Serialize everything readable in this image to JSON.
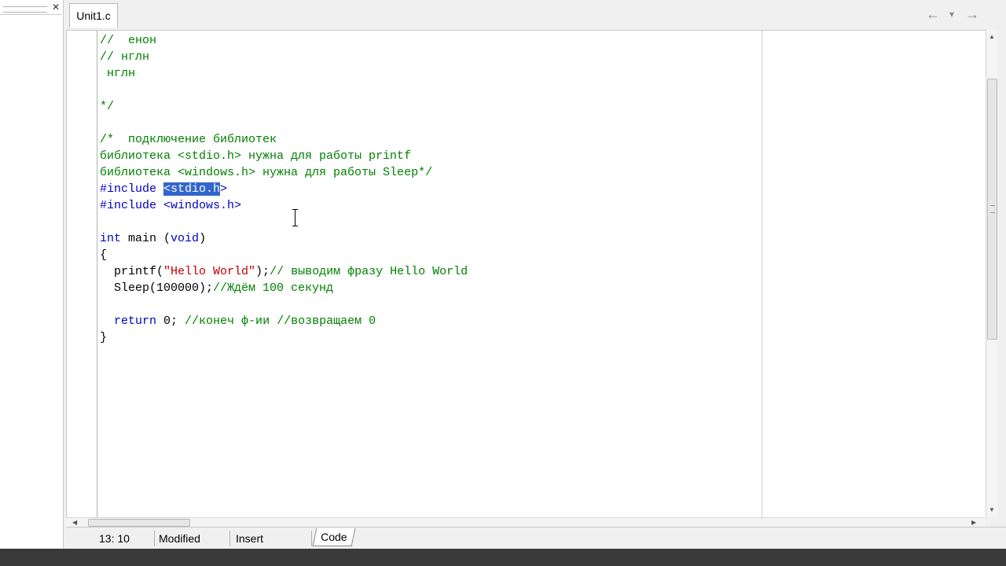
{
  "tab": {
    "label": "Unit1.c"
  },
  "nav": {
    "back": "←",
    "dropdown": "▾",
    "forward": "→"
  },
  "code_lines": [
    [
      {
        "t": "//  енон",
        "c": "cm"
      }
    ],
    [
      {
        "t": "// нглн",
        "c": "cm"
      }
    ],
    [
      {
        "t": " нглн",
        "c": "cm"
      }
    ],
    [
      {
        "t": "",
        "c": ""
      }
    ],
    [
      {
        "t": "*/",
        "c": "cm"
      }
    ],
    [
      {
        "t": "",
        "c": ""
      }
    ],
    [
      {
        "t": "/*  подключение библиотек",
        "c": "cm"
      }
    ],
    [
      {
        "t": "библиотека <stdio.h> нужна для работы printf",
        "c": "cm"
      }
    ],
    [
      {
        "t": "библиотека <windows.h> нужна для работы Sleep*/",
        "c": "cm"
      }
    ],
    [
      {
        "t": "#include ",
        "c": "pp"
      },
      {
        "t": "<stdio.h",
        "c": "sel"
      },
      {
        "t": ">",
        "c": "pp"
      }
    ],
    [
      {
        "t": "#include <windows.h>",
        "c": "pp"
      }
    ],
    [
      {
        "t": "",
        "c": ""
      }
    ],
    [
      {
        "t": "int",
        "c": "kw"
      },
      {
        "t": " main ",
        "c": ""
      },
      {
        "t": "(",
        "c": ""
      },
      {
        "t": "void",
        "c": "kw"
      },
      {
        "t": ")",
        "c": ""
      }
    ],
    [
      {
        "t": "{",
        "c": ""
      }
    ],
    [
      {
        "t": "  printf(",
        "c": ""
      },
      {
        "t": "\"Hello World\"",
        "c": "str"
      },
      {
        "t": ");",
        "c": ""
      },
      {
        "t": "// выводим фразу Hello World",
        "c": "cm"
      }
    ],
    [
      {
        "t": "  Sleep(100000);",
        "c": ""
      },
      {
        "t": "//Ждём 100 секунд",
        "c": "cm"
      }
    ],
    [
      {
        "t": "",
        "c": ""
      }
    ],
    [
      {
        "t": "  ",
        "c": ""
      },
      {
        "t": "return",
        "c": "kw"
      },
      {
        "t": " 0; ",
        "c": ""
      },
      {
        "t": "//конеч ф-ии //возвращаем 0",
        "c": "cm"
      }
    ],
    [
      {
        "t": "}",
        "c": ""
      }
    ]
  ],
  "status": {
    "position": "13: 10",
    "modified": "Modified",
    "mode": "Insert",
    "view_tab": "Code"
  },
  "colors": {
    "comment": "#008000",
    "keyword": "#0000c0",
    "string": "#c00000",
    "selection": "#3366cc"
  }
}
